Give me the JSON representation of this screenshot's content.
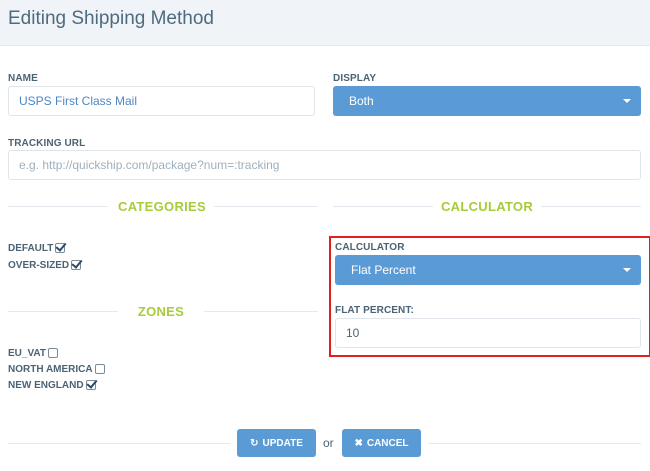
{
  "page": {
    "title": "Editing Shipping Method"
  },
  "form": {
    "name_label": "NAME",
    "name_value": "USPS First Class Mail",
    "display_label": "DISPLAY",
    "display_value": "Both",
    "tracking_label": "TRACKING URL",
    "tracking_placeholder": "e.g. http://quickship.com/package?num=:tracking"
  },
  "categories": {
    "title": "CATEGORIES",
    "items": [
      {
        "label": "DEFAULT",
        "checked": true
      },
      {
        "label": "OVER-SIZED",
        "checked": true
      }
    ]
  },
  "zones": {
    "title": "ZONES",
    "items": [
      {
        "label": "EU_VAT",
        "checked": false
      },
      {
        "label": "NORTH AMERICA",
        "checked": false
      },
      {
        "label": "NEW ENGLAND",
        "checked": true
      }
    ]
  },
  "calculator": {
    "section_title": "CALCULATOR",
    "label": "CALCULATOR",
    "value": "Flat Percent",
    "percent_label": "FLAT PERCENT:",
    "percent_value": "10"
  },
  "actions": {
    "update_label": "UPDATE",
    "or_label": "or",
    "cancel_label": "CANCEL"
  },
  "colors": {
    "accent": "#5b9bd5",
    "section_title": "#a7cc3a",
    "highlight": "#e0201f"
  }
}
